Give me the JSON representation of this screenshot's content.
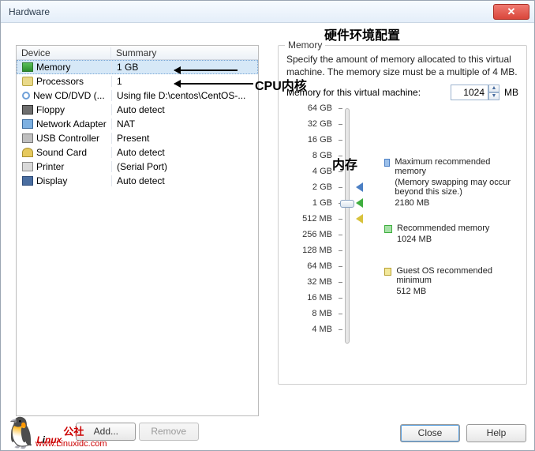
{
  "window": {
    "title": "Hardware"
  },
  "annotations": {
    "top": "硬件环境配置",
    "cpu": "CPU内核",
    "ram": "内存"
  },
  "devices": {
    "headers": {
      "device": "Device",
      "summary": "Summary"
    },
    "items": [
      {
        "name": "Memory",
        "summary": "1 GB",
        "icon": "ic-mem",
        "selected": true
      },
      {
        "name": "Processors",
        "summary": "1",
        "icon": "ic-cpu",
        "selected": false
      },
      {
        "name": "New CD/DVD (...",
        "summary": "Using file D:\\centos\\CentOS-...",
        "icon": "ic-cd",
        "selected": false
      },
      {
        "name": "Floppy",
        "summary": "Auto detect",
        "icon": "ic-flop",
        "selected": false
      },
      {
        "name": "Network Adapter",
        "summary": "NAT",
        "icon": "ic-net",
        "selected": false
      },
      {
        "name": "USB Controller",
        "summary": "Present",
        "icon": "ic-usb",
        "selected": false
      },
      {
        "name": "Sound Card",
        "summary": "Auto detect",
        "icon": "ic-snd",
        "selected": false
      },
      {
        "name": "Printer",
        "summary": "(Serial Port)",
        "icon": "ic-prn",
        "selected": false
      },
      {
        "name": "Display",
        "summary": "Auto detect",
        "icon": "ic-dsp",
        "selected": false
      }
    ]
  },
  "buttons": {
    "add": "Add...",
    "remove": "Remove",
    "close": "Close",
    "help": "Help"
  },
  "memory": {
    "legend": "Memory",
    "desc": "Specify the amount of memory allocated to this virtual machine. The memory size must be a multiple of 4 MB.",
    "label": "Memory for this virtual machine:",
    "value": "1024",
    "unit": "MB",
    "ticks": [
      "64 GB",
      "32 GB",
      "16 GB",
      "8 GB",
      "4 GB",
      "2 GB",
      "1 GB",
      "512 MB",
      "256 MB",
      "128 MB",
      "64 MB",
      "32 MB",
      "16 MB",
      "8 MB",
      "4 MB"
    ],
    "current_index": 6,
    "markers": {
      "max_index": 5,
      "rec_index": 6,
      "min_index": 7
    },
    "legend_max": {
      "title": "Maximum recommended memory",
      "note": "(Memory swapping may occur beyond this size.)",
      "value": "2180 MB"
    },
    "legend_rec": {
      "title": "Recommended memory",
      "value": "1024 MB"
    },
    "legend_guest": {
      "title": "Guest OS recommended minimum",
      "value": "512 MB"
    }
  },
  "logo": {
    "brand_l": "L",
    "brand_i": "i",
    "brand_rest": "nux",
    "cn": "公社",
    "url": "www.Linuxidc.com"
  }
}
